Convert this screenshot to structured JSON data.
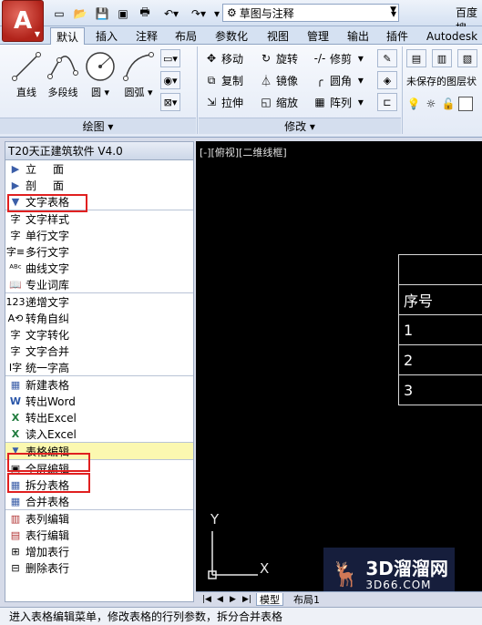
{
  "titlebar": {
    "doc_title": "草图与注释",
    "search_hint": "百度搜"
  },
  "ribbon_tabs": [
    "默认",
    "插入",
    "注释",
    "布局",
    "参数化",
    "视图",
    "管理",
    "输出",
    "插件",
    "Autodesk"
  ],
  "draw_panel": {
    "label": "绘图",
    "tools": [
      "直线",
      "多段线",
      "圆",
      "圆弧"
    ]
  },
  "modify_panel": {
    "label": "修改",
    "tools": [
      "移动",
      "旋转",
      "修剪",
      "复制",
      "镜像",
      "圆角",
      "拉伸",
      "缩放",
      "阵列"
    ]
  },
  "layers_panel": {
    "status": "未保存的图层状"
  },
  "left_panel": {
    "title": "T20天正建筑软件 V4.0",
    "top_menu": [
      "立面",
      "剖面",
      "文字表格"
    ],
    "text_group_1": [
      "文字样式",
      "单行文字",
      "多行文字",
      "曲线文字",
      "专业词库"
    ],
    "text_group_2": [
      "递增文字",
      "转角自纠",
      "文字转化",
      "文字合并",
      "统一字高"
    ],
    "table_group": [
      "新建表格",
      "转出Word",
      "转出Excel",
      "读入Excel"
    ],
    "table_edit_header": "表格编辑",
    "edit_group_1": [
      "全屏编辑",
      "拆分表格",
      "合并表格"
    ],
    "edit_group_2": [
      "表列编辑",
      "表行编辑",
      "增加表行",
      "删除表行"
    ]
  },
  "canvas": {
    "viewport_label": "[-][俯视][二维线框]",
    "table_rows": [
      "",
      "序号",
      "1",
      "2",
      "3"
    ],
    "ucs_x": "X",
    "ucs_y": "Y",
    "layout_tabs": [
      "模型",
      "布局1"
    ]
  },
  "watermark": {
    "line1": "3D溜溜网",
    "line2": "3D66.COM"
  },
  "statusbar": {
    "text": "进入表格编辑菜单，修改表格的行列参数，拆分合并表格"
  },
  "colors": {
    "highlight_box": "#e02020",
    "selected_row": "#fbf8b0",
    "canvas_bg": "#000000"
  }
}
